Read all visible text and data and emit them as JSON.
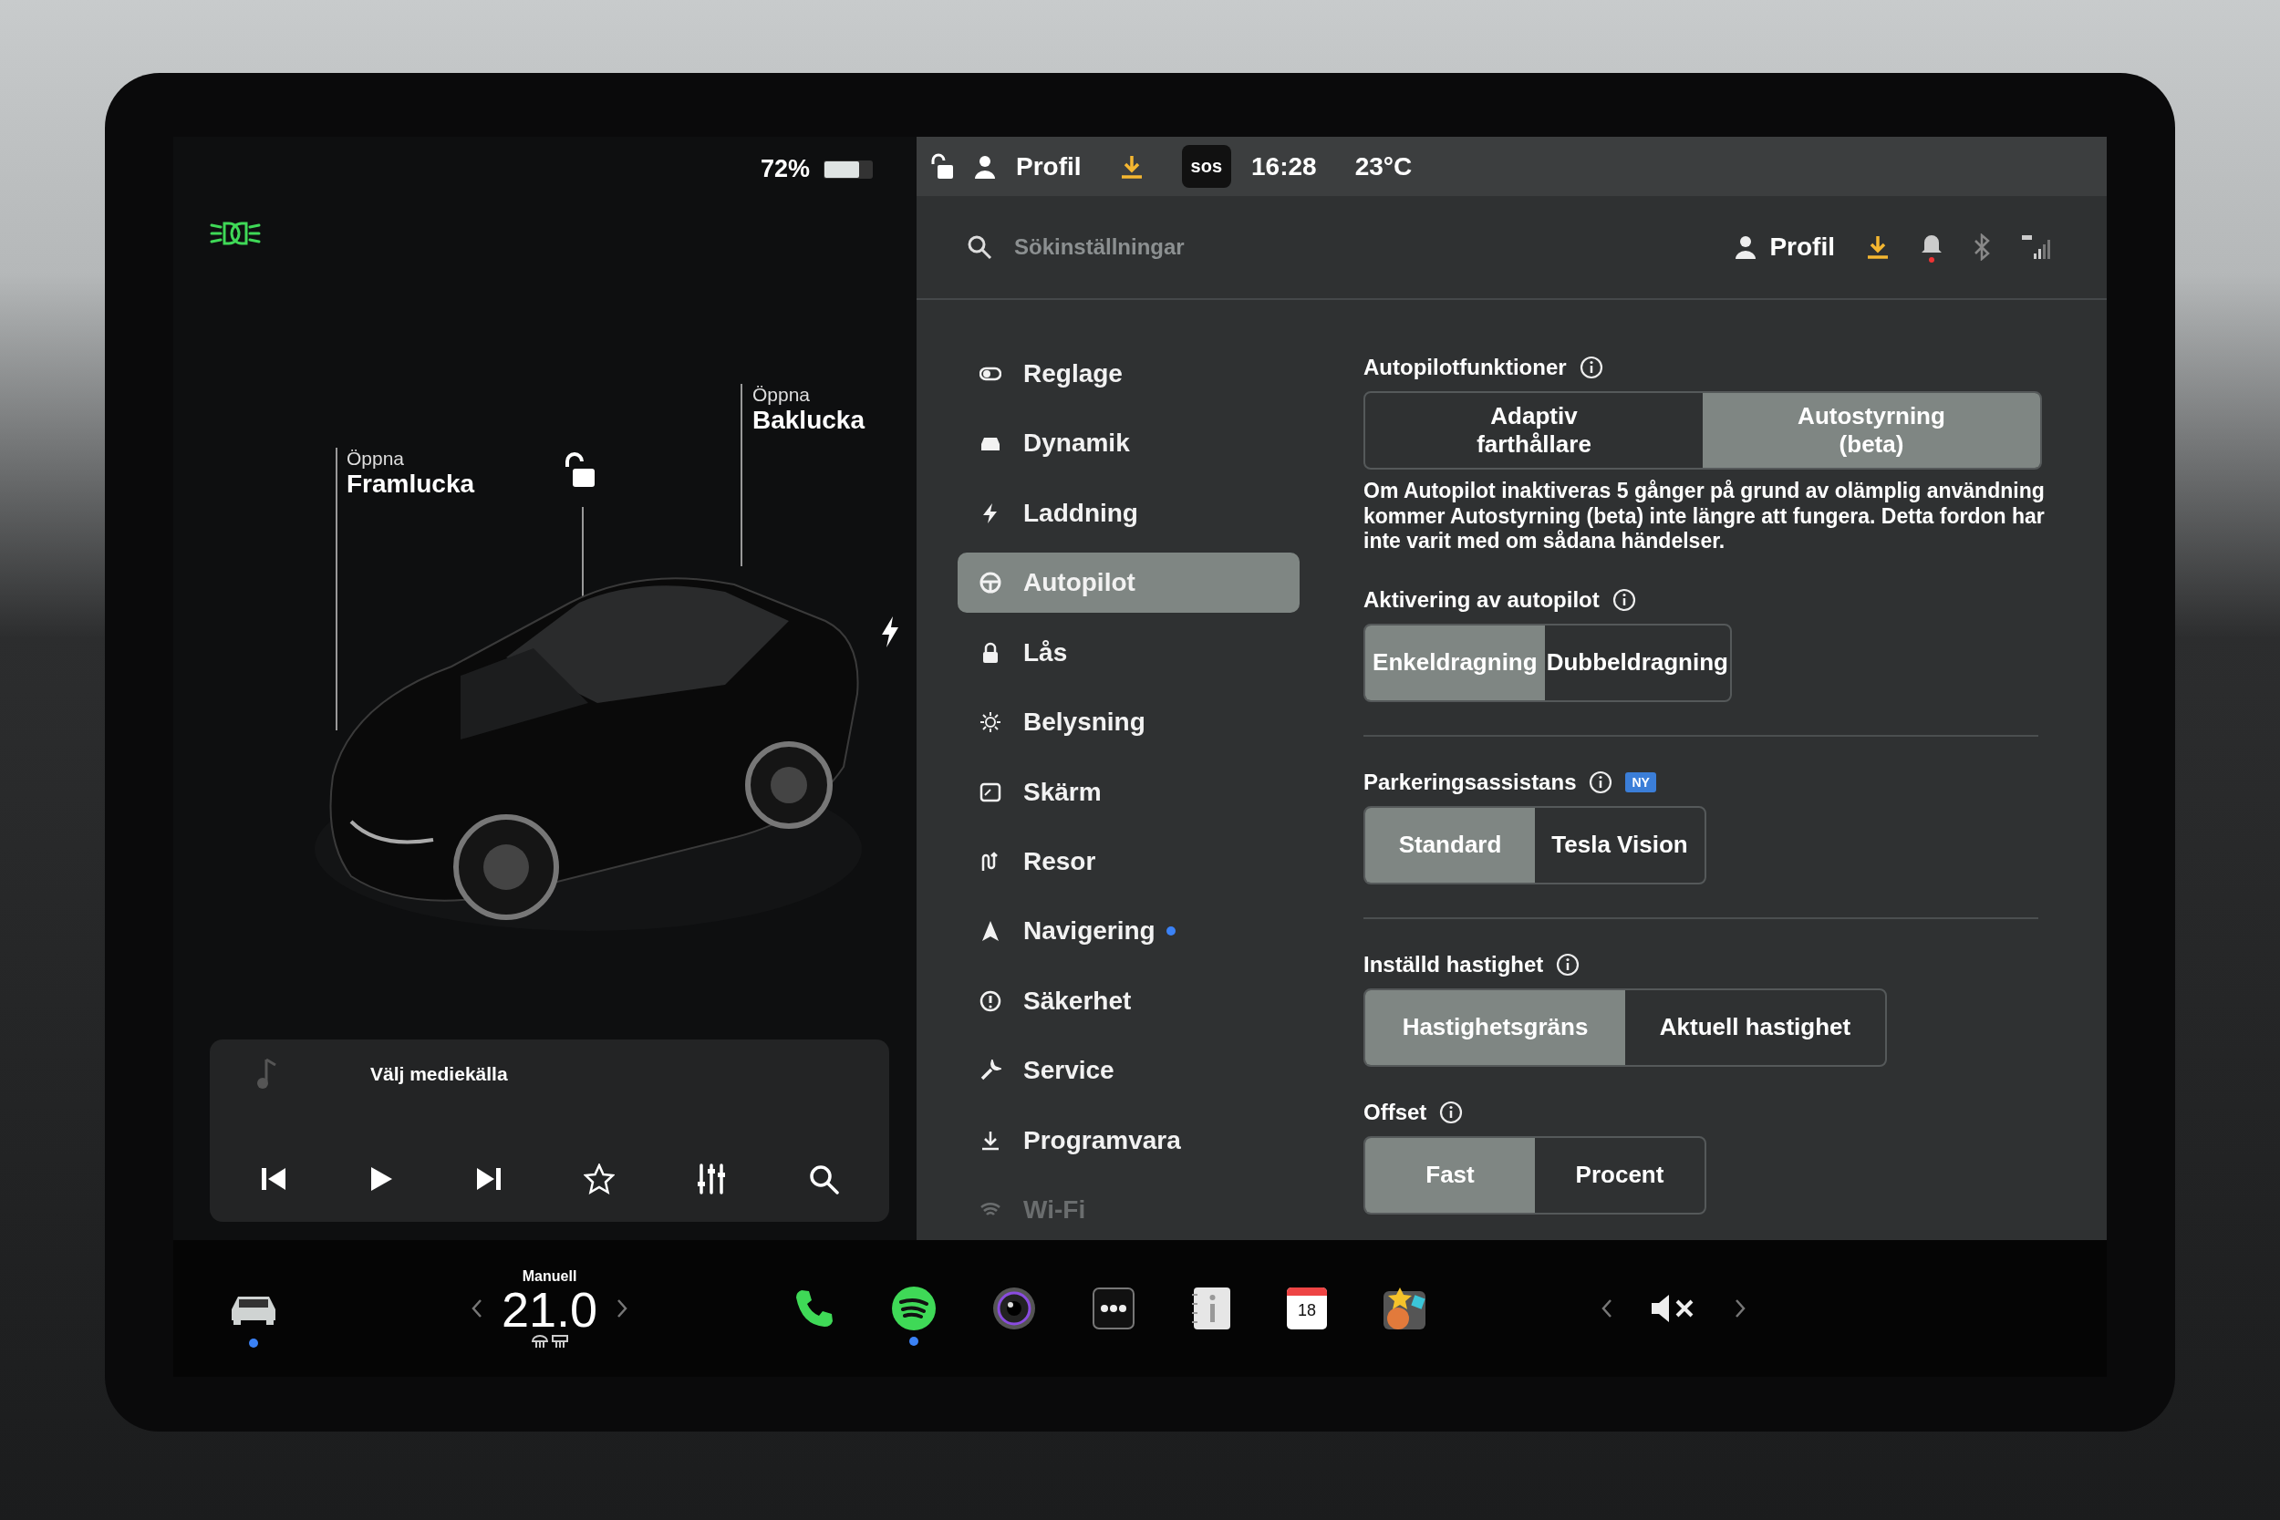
{
  "left_panel": {
    "battery": "72%",
    "car_labels": [
      {
        "action": "Öppna",
        "name": "Framlucka"
      },
      {
        "action": "Öppna",
        "name": "Baklucka"
      }
    ],
    "media": {
      "source": "Välj mediekälla"
    }
  },
  "top_bar": {
    "profile": "Profil",
    "sos": "sos",
    "time": "16:28",
    "temperature": "23°C"
  },
  "settings_header": {
    "search": {
      "placeholder": "Sökinställningar"
    },
    "profile": "Profil"
  },
  "sidebar": {
    "items": [
      {
        "label": "Reglage",
        "selected": false,
        "dot": false,
        "faded": false
      },
      {
        "label": "Dynamik",
        "selected": false,
        "dot": false,
        "faded": false
      },
      {
        "label": "Laddning",
        "selected": false,
        "dot": false,
        "faded": false
      },
      {
        "label": "Autopilot",
        "selected": true,
        "dot": false,
        "faded": false
      },
      {
        "label": "Lås",
        "selected": false,
        "dot": false,
        "faded": false
      },
      {
        "label": "Belysning",
        "selected": false,
        "dot": false,
        "faded": false
      },
      {
        "label": "Skärm",
        "selected": false,
        "dot": false,
        "faded": false
      },
      {
        "label": "Resor",
        "selected": false,
        "dot": false,
        "faded": false
      },
      {
        "label": "Navigering",
        "selected": false,
        "dot": true,
        "faded": false
      },
      {
        "label": "Säkerhet",
        "selected": false,
        "dot": false,
        "faded": false
      },
      {
        "label": "Service",
        "selected": false,
        "dot": false,
        "faded": false
      },
      {
        "label": "Programvara",
        "selected": false,
        "dot": false,
        "faded": false
      },
      {
        "label": "Wi-Fi",
        "selected": false,
        "dot": false,
        "faded": true
      }
    ]
  },
  "sections": [
    {
      "title": "Autopilotfunktioner",
      "options": [
        {
          "label": "Adaptiv\nfarthållare",
          "selected": false
        },
        {
          "label": "Autostyrning\n(beta)",
          "selected": true
        }
      ],
      "description": "Om Autopilot inaktiveras 5 gånger på grund av olämplig användning kommer Autostyrning (beta) inte längre att fungera. Detta fordon har inte varit med om sådana händelser.",
      "divider_after": false
    },
    {
      "title": "Aktivering av autopilot",
      "options": [
        {
          "label": "Enkeldragning",
          "selected": true
        },
        {
          "label": "Dubbeldragning",
          "selected": false
        }
      ],
      "divider_after": true
    },
    {
      "title": "Parkeringsassistans",
      "badge": "NY",
      "options": [
        {
          "label": "Standard",
          "selected": true
        },
        {
          "label": "Tesla Vision",
          "selected": false
        }
      ],
      "divider_after": true
    },
    {
      "title": "Inställd hastighet",
      "options": [
        {
          "label": "Hastighetsgräns",
          "selected": true
        },
        {
          "label": "Aktuell hastighet",
          "selected": false
        }
      ],
      "divider_after": false
    },
    {
      "title": "Offset",
      "options": [
        {
          "label": "Fast",
          "selected": true
        },
        {
          "label": "Procent",
          "selected": false
        }
      ],
      "divider_after": false
    }
  ],
  "dock": {
    "climate": {
      "mode": "Manuell",
      "temperature": "21.0"
    },
    "calendar_day": "18"
  }
}
